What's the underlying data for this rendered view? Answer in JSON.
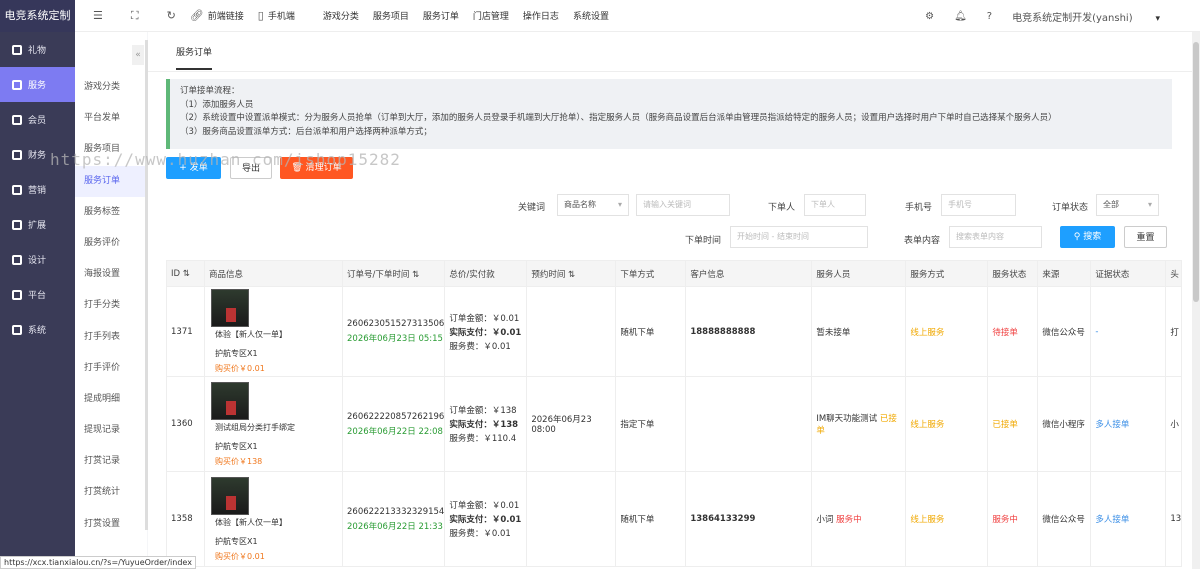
{
  "app": {
    "title": "电竞系统定制"
  },
  "sidebar": {
    "items": [
      {
        "label": "礼物",
        "icon": "gift-icon"
      },
      {
        "label": "服务",
        "icon": "service-icon"
      },
      {
        "label": "会员",
        "icon": "member-icon"
      },
      {
        "label": "财务",
        "icon": "finance-icon"
      },
      {
        "label": "营销",
        "icon": "marketing-icon"
      },
      {
        "label": "扩展",
        "icon": "extend-icon"
      },
      {
        "label": "设计",
        "icon": "design-icon"
      },
      {
        "label": "平台",
        "icon": "platform-icon"
      },
      {
        "label": "系统",
        "icon": "system-icon"
      }
    ],
    "active": 1
  },
  "subnav": {
    "items": [
      "游戏分类",
      "平台发单",
      "服务项目",
      "服务订单",
      "服务标签",
      "服务评价",
      "海报设置",
      "打手分类",
      "打手列表",
      "打手评价",
      "提成明细",
      "提现记录",
      "打赏记录",
      "打赏统计",
      "打赏设置"
    ],
    "active": 3,
    "collapse": "«"
  },
  "topbar": {
    "links": [
      {
        "label": "前端链接",
        "icon": "link-icon"
      },
      {
        "label": "手机端",
        "icon": "mobile-icon"
      }
    ],
    "menu": [
      "游戏分类",
      "服务项目",
      "服务订单",
      "门店管理",
      "操作日志",
      "系统设置"
    ],
    "user": "电竞系统定制开发(yanshi)"
  },
  "tab": {
    "label": "服务订单"
  },
  "note": {
    "lines": [
      "订单接单流程：",
      "（1）添加服务人员",
      "（2）系统设置中设置派单模式：分为服务人员抢单（订单到大厅，添加的服务人员登录手机端到大厅抢单）、指定服务人员（服务商品设置后台派单由管理员指派给特定的服务人员；设置用户选择时用户下单时自己选择某个服务人员）",
      "（3）服务商品设置派单方式：后台派单和用户选择两种派单方式；"
    ]
  },
  "buttons": {
    "add": "+ 发单",
    "export": "导出",
    "clear": "清理订单",
    "search": "搜索",
    "reset": "重置"
  },
  "filters": {
    "keyword_label": "关键词",
    "keyword_select": "商品名称",
    "keyword_placeholder": "请输入关键词",
    "orderer_label": "下单人",
    "orderer_placeholder": "下单人",
    "phone_label": "手机号",
    "phone_placeholder": "手机号",
    "status_label": "订单状态",
    "status_value": "全部",
    "time_label": "下单时间",
    "time_placeholder": "开始时间 - 结束时间",
    "form_label": "表单内容",
    "form_placeholder": "搜索表单内容"
  },
  "table": {
    "headers": [
      "ID ⇅",
      "商品信息",
      "订单号/下单时间 ⇅",
      "总价/实付款",
      "预约时间 ⇅",
      "下单方式",
      "客户信息",
      "服务人员",
      "服务方式",
      "服务状态",
      "来源",
      "证据状态",
      "头"
    ],
    "rows": [
      {
        "id": "1371",
        "product": "体验【新人仅一单】",
        "spec": "护航专区X1",
        "price": "购买价￥0.01",
        "order_no": "260623051527313506",
        "order_time": "2026年06月23日 05:15",
        "total": "订单金额：￥0.01",
        "paid": "实际支付：￥0.01",
        "fee": "服务费：￥0.01",
        "appointment": "",
        "method": "随机下单",
        "customer": "18888888888",
        "staff": "暂未接单",
        "staff_status": "",
        "mode": "线上服务",
        "status": "待接单",
        "source": "微信公众号",
        "evidence": "-",
        "extra": "打"
      },
      {
        "id": "1360",
        "product": "测试组局分类打手绑定",
        "spec": "护航专区X1",
        "price": "购买价￥138",
        "order_no": "260622220857262196",
        "order_time": "2026年06月22日 22:08",
        "total": "订单金额：￥138",
        "paid": "实际支付：￥138",
        "fee": "服务费：￥110.4",
        "appointment": "2026年06月23 08:00",
        "method": "指定下单",
        "customer": "",
        "staff": "IM聊天功能测试",
        "staff_status": "已接单",
        "mode": "线上服务",
        "status": "已接单",
        "source": "微信小程序",
        "evidence": "多人接单",
        "extra": "小"
      },
      {
        "id": "1358",
        "product": "体验【新人仅一单】",
        "spec": "护航专区X1",
        "price": "购买价￥0.01",
        "order_no": "260622213332329154",
        "order_time": "2026年06月22日 21:33",
        "total": "订单金额：￥0.01",
        "paid": "实际支付：￥0.01",
        "fee": "服务费：￥0.01",
        "appointment": "",
        "method": "随机下单",
        "customer": "13864133299",
        "staff": "小词",
        "staff_status": "服务中",
        "mode": "线上服务",
        "status": "服务中",
        "source": "微信公众号",
        "evidence": "多人接单",
        "extra": "13"
      }
    ]
  },
  "statusbar": "https://xcx.tianxialou.cn/?s=/YuyueOrder/index",
  "watermark": "https://www.huzhan.com/ishop15282"
}
